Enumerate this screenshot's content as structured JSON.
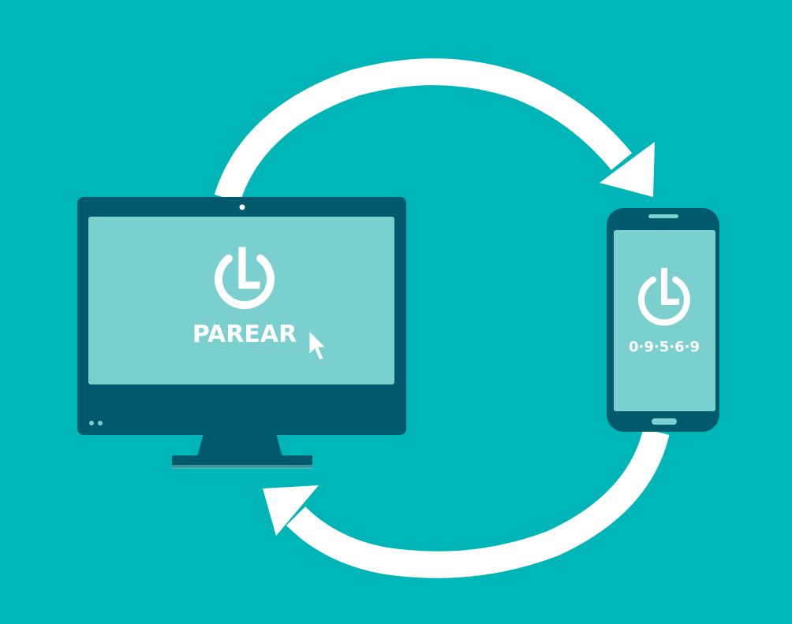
{
  "desktop": {
    "button_label": "PAREAR",
    "icon": "power-l-logo-icon",
    "cursor": "mouse-pointer-icon"
  },
  "phone": {
    "code": "0·9·5·6·9",
    "icon": "power-l-logo-icon"
  },
  "colors": {
    "background": "#00b5b8",
    "device_frame": "#005a6b",
    "screen": "#7ccfcf",
    "arrow": "#ffffff",
    "text": "#ffffff"
  }
}
